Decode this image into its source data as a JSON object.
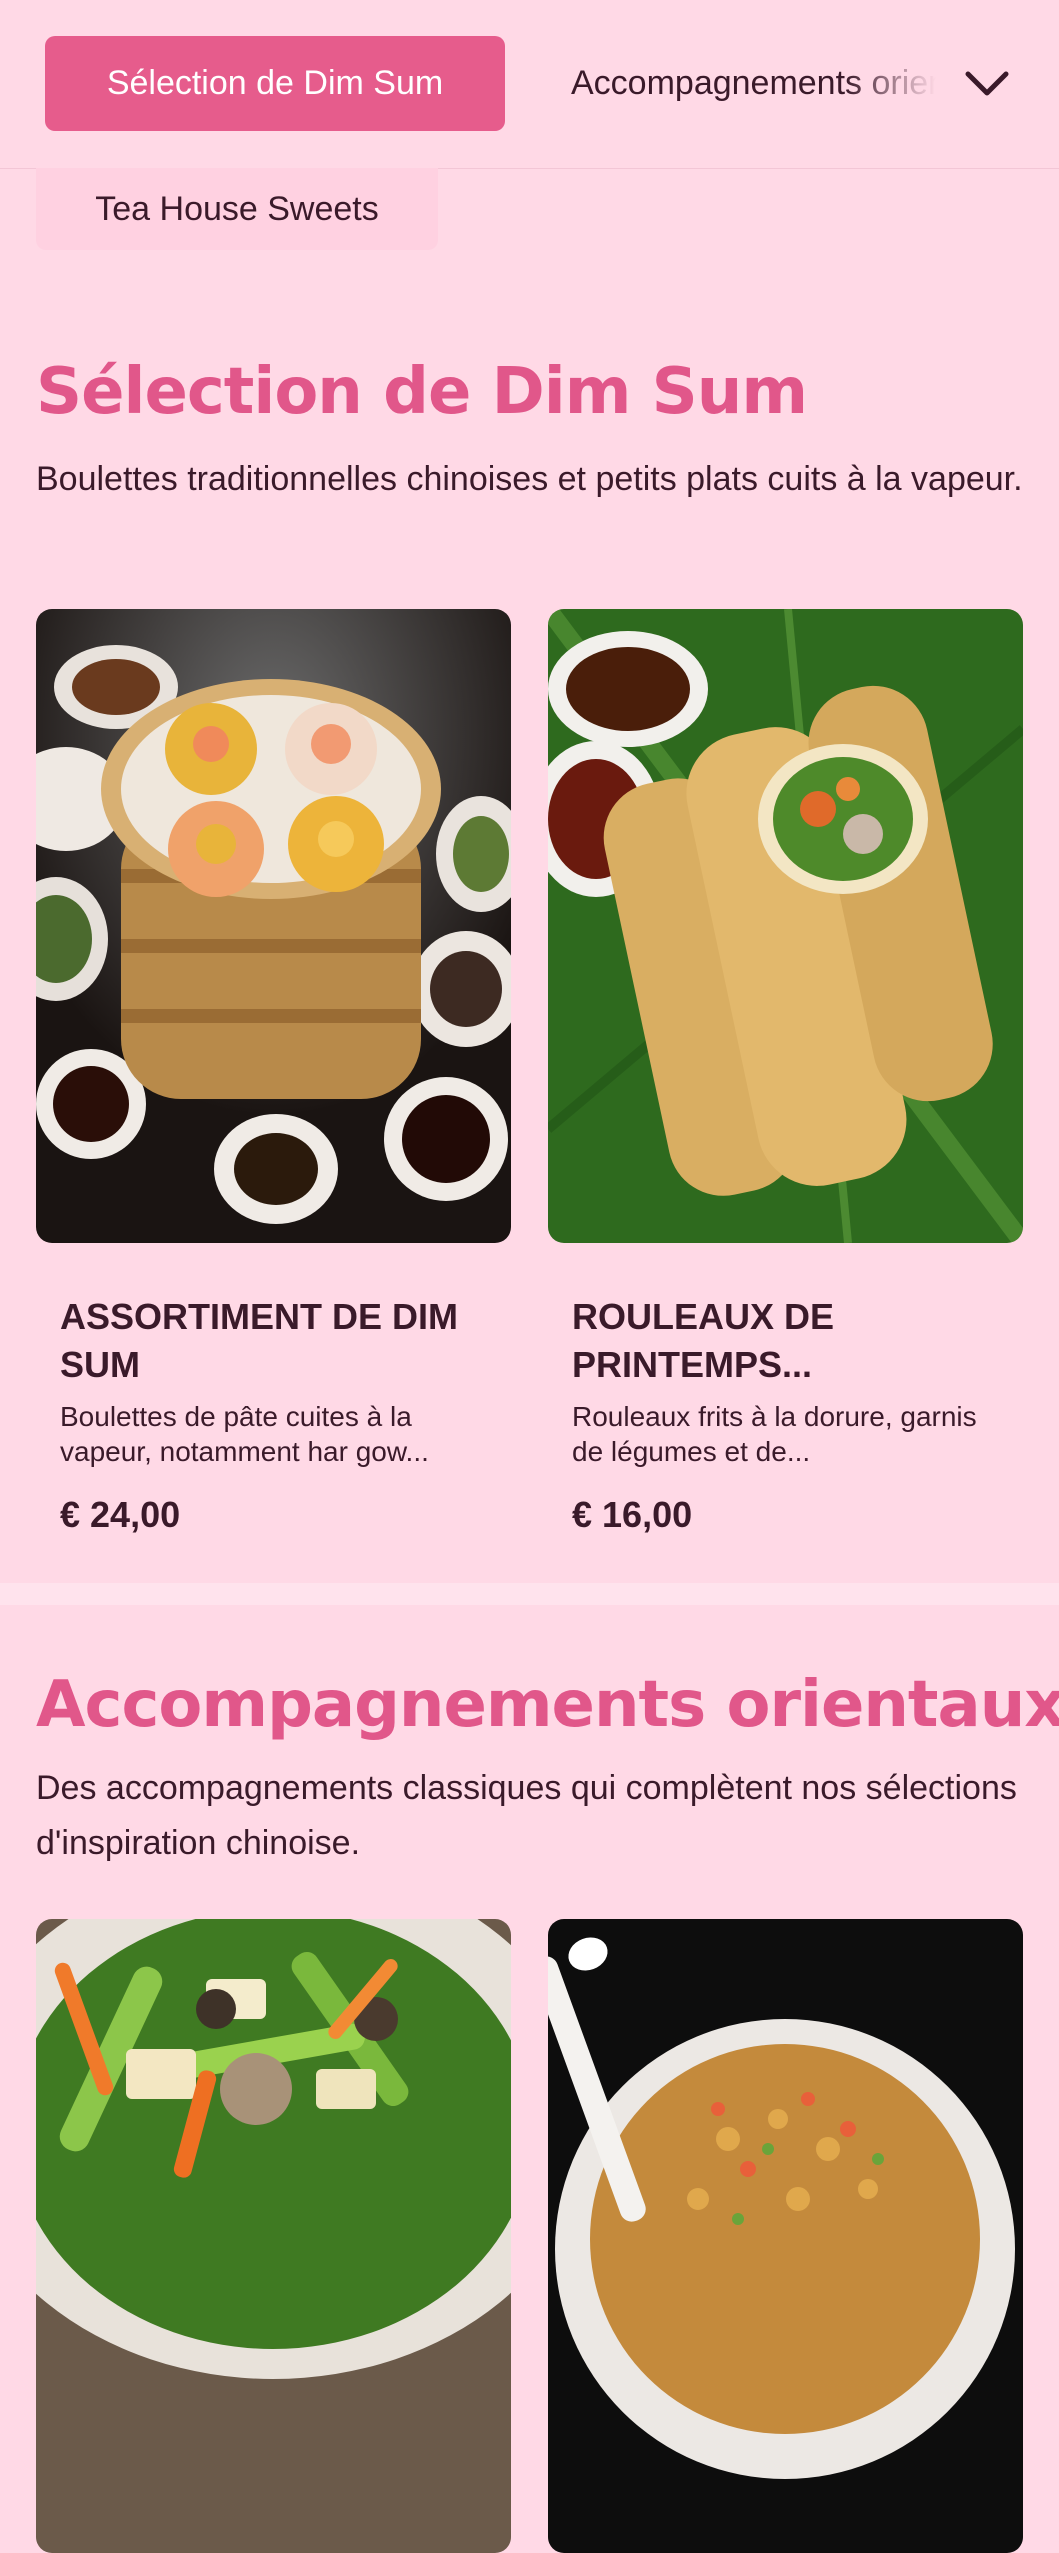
{
  "nav": {
    "active_category": "Sélection de Dim Sum",
    "next_category": "Accompagnements orientaux",
    "second_row_category": "Tea House Sweets"
  },
  "sections": [
    {
      "title": "Sélection de Dim Sum",
      "description": "Boulettes traditionnelles chinoises et petits plats cuits à la vapeur.",
      "items": [
        {
          "name": "ASSORTIMENT DE DIM SUM",
          "description": "Boulettes de pâte cuites à la vapeur, notamment har gow...",
          "price": "€ 24,00"
        },
        {
          "name": "ROULEAUX DE PRINTEMPS...",
          "description": "Rouleaux frits à la dorure, garnis de légumes et de...",
          "price": "€ 16,00"
        }
      ]
    },
    {
      "title": "Accompagnements orientaux",
      "description": "Des accompagnements classiques qui complètent nos sélections d'inspiration chinoise."
    }
  ],
  "colors": {
    "background": "#ffd9e6",
    "accent": "#e65c8c",
    "heading": "#e1578a",
    "text": "#3a1a2a"
  },
  "icons": {
    "expand": "chevron-down-icon"
  }
}
